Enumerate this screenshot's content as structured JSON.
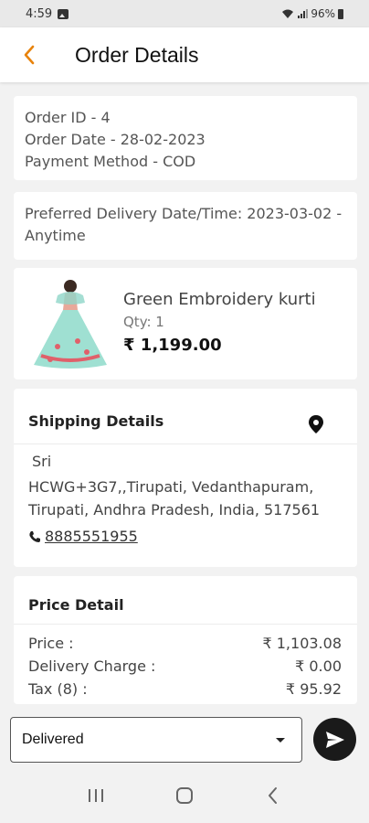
{
  "status_bar": {
    "time": "4:59",
    "battery": "96%"
  },
  "header": {
    "title": "Order Details",
    "back_icon": "chevron-left-icon",
    "accent_color": "#e8830c"
  },
  "order_info": {
    "order_id": "Order ID - 4",
    "order_date": "Order Date - 28-02-2023",
    "payment_method": "Payment Method - COD"
  },
  "delivery_preference": {
    "line1": "Preferred Delivery Date/Time: 2023-03-02 -",
    "line2": "Anytime"
  },
  "product": {
    "name": "Green Embroidery kurti",
    "qty": "Qty: 1",
    "price": "₹ 1,199.00"
  },
  "shipping": {
    "title": "Shipping Details",
    "name": "Sri",
    "address_line1": "HCWG+3G7,,Tirupati, Vedanthapuram,",
    "address_line2": "Tirupati, Andhra Pradesh, India, 517561",
    "phone": " 8885551955"
  },
  "price_detail": {
    "title": "Price Detail",
    "rows": [
      {
        "label": "Price :",
        "value": "₹ 1,103.08"
      },
      {
        "label": "Delivery Charge :",
        "value": "₹ 0.00"
      },
      {
        "label": "Tax (8) :",
        "value": "₹ 95.92"
      }
    ]
  },
  "order_status": {
    "selected": "Delivered"
  }
}
